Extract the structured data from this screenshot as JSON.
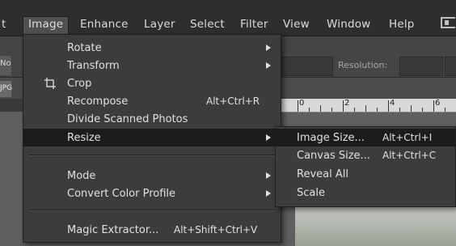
{
  "menubar": {
    "items": [
      {
        "label": "t"
      },
      {
        "label": "Image"
      },
      {
        "label": "Enhance"
      },
      {
        "label": "Layer"
      },
      {
        "label": "Select"
      },
      {
        "label": "Filter"
      },
      {
        "label": "View"
      },
      {
        "label": "Window"
      },
      {
        "label": "Help"
      }
    ]
  },
  "options_bar": {
    "left_tab": "No",
    "resolution_label": "Resolution:"
  },
  "doc_tab": "JPG",
  "ruler": {
    "numbers": [
      "0",
      "2",
      "4",
      "6"
    ]
  },
  "image_menu": {
    "items": [
      {
        "label": "Rotate",
        "shortcut": "",
        "submenu": true
      },
      {
        "label": "Transform",
        "shortcut": "",
        "submenu": true
      },
      {
        "label": "Crop",
        "shortcut": "",
        "submenu": false,
        "icon": "crop-icon"
      },
      {
        "label": "Recompose",
        "shortcut": "Alt+Ctrl+R",
        "submenu": false
      },
      {
        "label": "Divide Scanned Photos",
        "shortcut": "",
        "submenu": false
      },
      {
        "label": "Resize",
        "shortcut": "",
        "submenu": true,
        "highlighted": true
      },
      {
        "label": "Mode",
        "shortcut": "",
        "submenu": true
      },
      {
        "label": "Convert Color Profile",
        "shortcut": "",
        "submenu": true
      },
      {
        "label": "Magic Extractor...",
        "shortcut": "Alt+Shift+Ctrl+V",
        "submenu": false
      }
    ]
  },
  "resize_submenu": {
    "items": [
      {
        "label": "Image Size...",
        "shortcut": "Alt+Ctrl+I",
        "highlighted": true
      },
      {
        "label": "Canvas Size...",
        "shortcut": "Alt+Ctrl+C"
      },
      {
        "label": "Reveal All",
        "shortcut": ""
      },
      {
        "label": "Scale",
        "shortcut": ""
      }
    ]
  },
  "colors": {
    "menu_bg": "#3c3c3c",
    "highlight_bg": "#1c1c1c",
    "menubar_bg": "#2e2e2e",
    "text": "#e0e0e0"
  }
}
